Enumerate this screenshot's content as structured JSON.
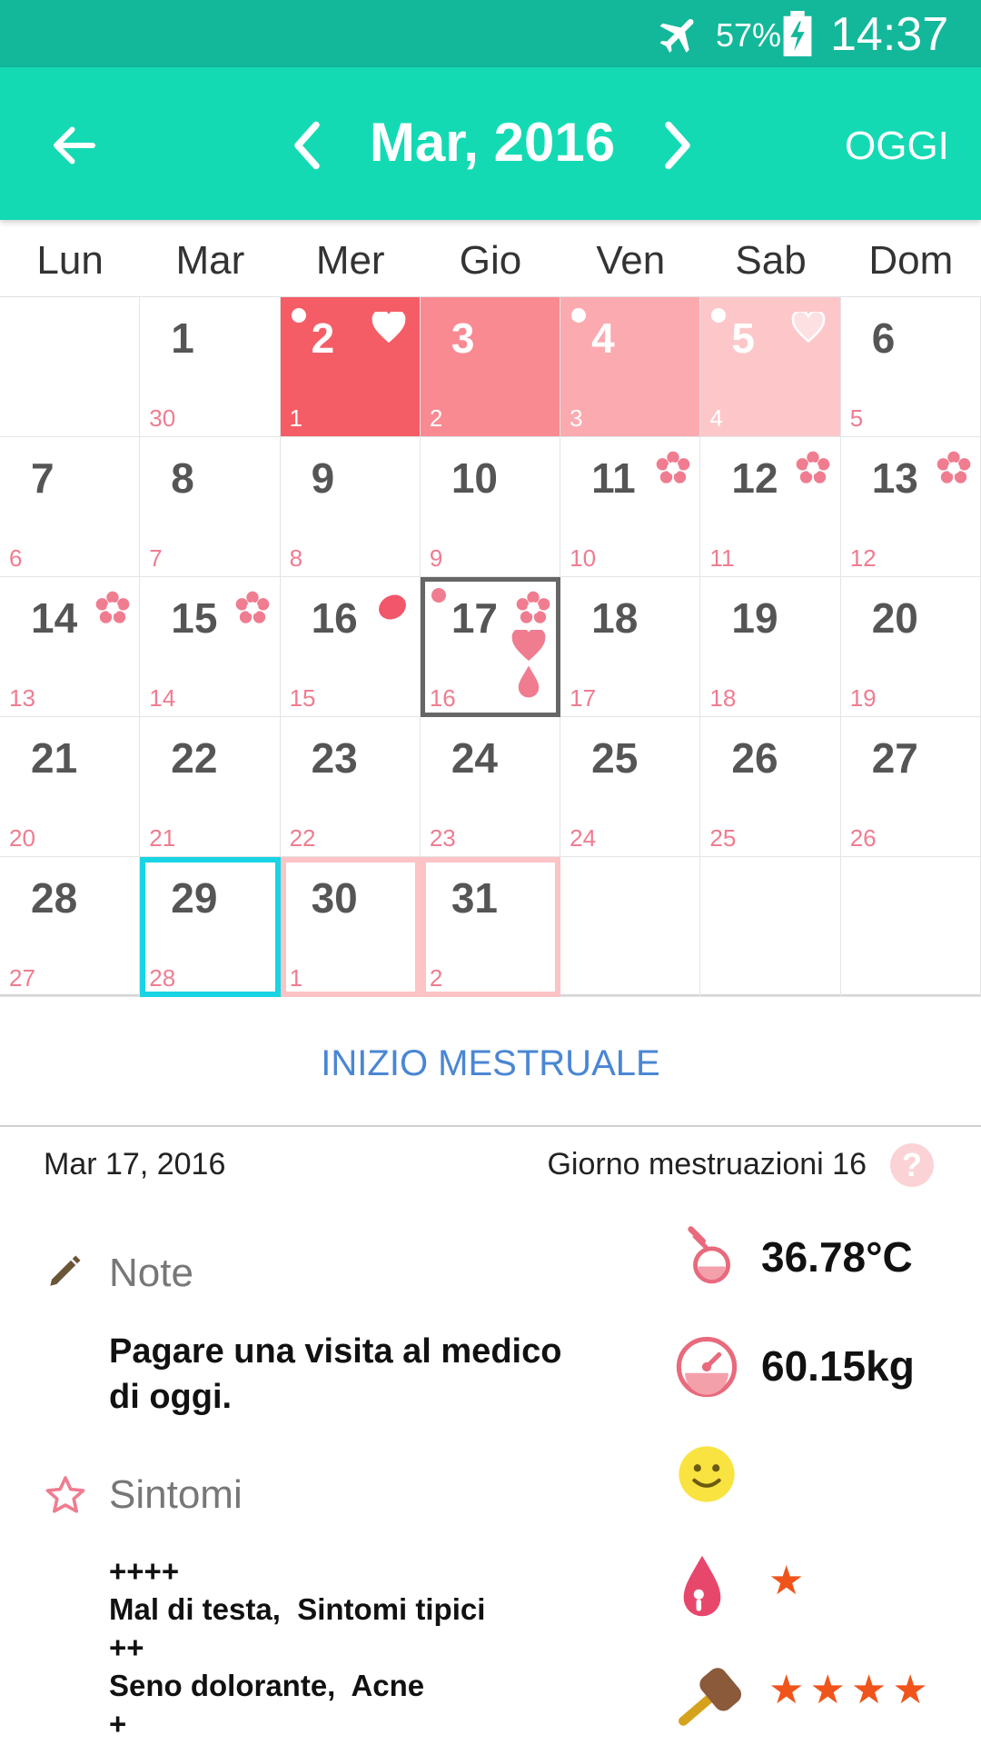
{
  "status_bar": {
    "battery": "57%",
    "time": "14:37"
  },
  "app_bar": {
    "month": "Mar, 2016",
    "today_label": "OGGI"
  },
  "weekdays": [
    "Lun",
    "Mar",
    "Mer",
    "Gio",
    "Ven",
    "Sab",
    "Dom"
  ],
  "calendar": {
    "rows": [
      [
        {
          "day": "",
          "cycle": ""
        },
        {
          "day": "1",
          "cycle": "30"
        },
        {
          "day": "2",
          "cycle": "1"
        },
        {
          "day": "3",
          "cycle": "2"
        },
        {
          "day": "4",
          "cycle": "3"
        },
        {
          "day": "5",
          "cycle": "4"
        },
        {
          "day": "6",
          "cycle": "5"
        }
      ],
      [
        {
          "day": "7",
          "cycle": "6"
        },
        {
          "day": "8",
          "cycle": "7"
        },
        {
          "day": "9",
          "cycle": "8"
        },
        {
          "day": "10",
          "cycle": "9"
        },
        {
          "day": "11",
          "cycle": "10"
        },
        {
          "day": "12",
          "cycle": "11"
        },
        {
          "day": "13",
          "cycle": "12"
        }
      ],
      [
        {
          "day": "14",
          "cycle": "13"
        },
        {
          "day": "15",
          "cycle": "14"
        },
        {
          "day": "16",
          "cycle": "15"
        },
        {
          "day": "17",
          "cycle": "16"
        },
        {
          "day": "18",
          "cycle": "17"
        },
        {
          "day": "19",
          "cycle": "18"
        },
        {
          "day": "20",
          "cycle": "19"
        }
      ],
      [
        {
          "day": "21",
          "cycle": "20"
        },
        {
          "day": "22",
          "cycle": "21"
        },
        {
          "day": "23",
          "cycle": "22"
        },
        {
          "day": "24",
          "cycle": "23"
        },
        {
          "day": "25",
          "cycle": "24"
        },
        {
          "day": "26",
          "cycle": "25"
        },
        {
          "day": "27",
          "cycle": "26"
        }
      ],
      [
        {
          "day": "28",
          "cycle": "27"
        },
        {
          "day": "29",
          "cycle": "28"
        },
        {
          "day": "30",
          "cycle": "1"
        },
        {
          "day": "31",
          "cycle": "2"
        },
        {
          "day": "",
          "cycle": ""
        },
        {
          "day": "",
          "cycle": ""
        },
        {
          "day": "",
          "cycle": ""
        }
      ]
    ],
    "period_days": [
      "2",
      "3",
      "4",
      "5"
    ],
    "fertile_days": [
      "11",
      "12",
      "13",
      "14",
      "15",
      "17"
    ],
    "ovulation_day": "16",
    "selected_day": "17",
    "current_day": "29",
    "predicted_period_days": [
      "30",
      "31"
    ]
  },
  "period_button": "INIZIO MESTRUALE",
  "details": {
    "date": "Mar 17, 2016",
    "cycle_day": "Giorno mestruazioni 16",
    "help": "?",
    "note_title": "Note",
    "note_text": "Pagare una visita al medico di oggi.",
    "symptoms_title": "Sintomi",
    "symptom_lines": [
      "++++",
      "Mal di testa,  Sintomi tipici",
      "++",
      "Seno dolorante,  Acne",
      "+"
    ],
    "temperature": "36.78°C",
    "weight": "60.15kg",
    "mood": "happy",
    "flow_rating": 1,
    "intercourse_rating": 4
  },
  "colors": {
    "status_bar": "#13b89a",
    "app_bar": "#14dab4",
    "period": "#f55d66",
    "accent_pink": "#f07c90",
    "today_outline": "#18d4e4",
    "link": "#4a86d4",
    "star": "#f0541b"
  }
}
